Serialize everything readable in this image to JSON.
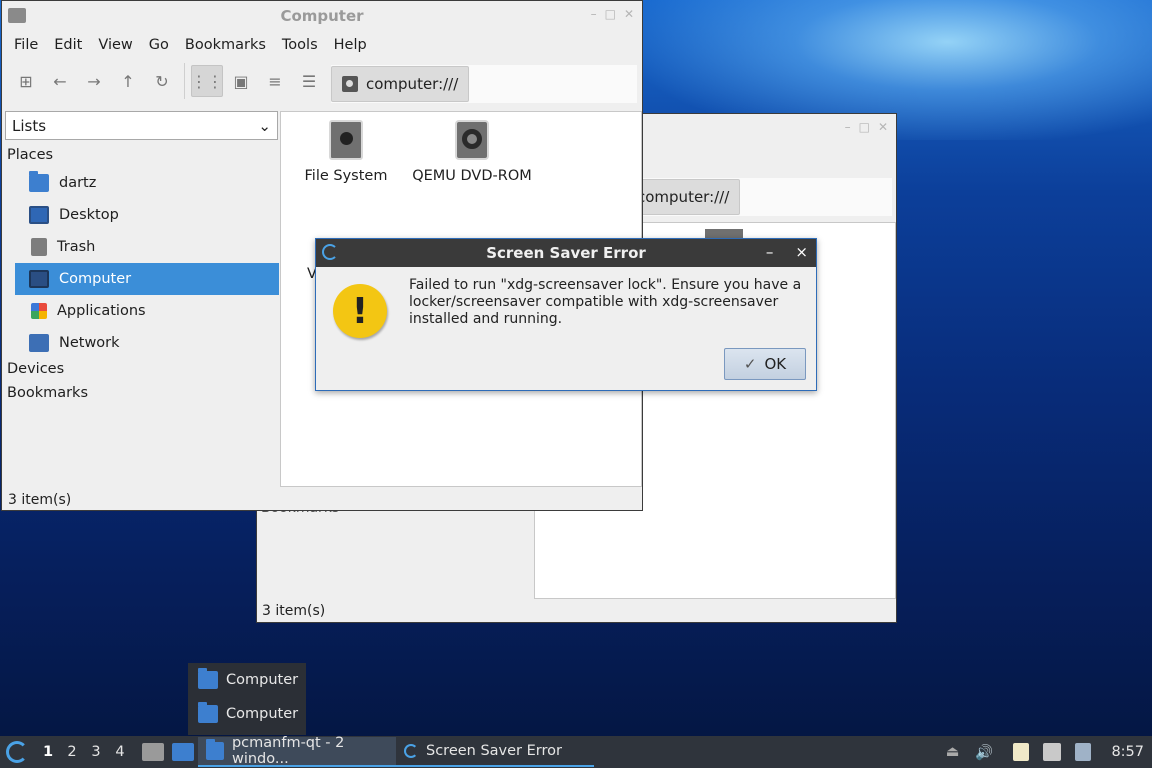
{
  "back_window": {
    "path": "computer:///",
    "section_label": "Bookmarks",
    "status": "3 item(s)"
  },
  "main_window": {
    "title": "Computer",
    "menu": [
      "File",
      "Edit",
      "View",
      "Go",
      "Bookmarks",
      "Tools",
      "Help"
    ],
    "path": "computer:///",
    "side_select": "Lists",
    "sections": {
      "places": "Places",
      "devices": "Devices",
      "bookmarks": "Bookmarks"
    },
    "places": [
      {
        "label": "dartz",
        "icon": "folder-icon"
      },
      {
        "label": "Desktop",
        "icon": "desktop-icon"
      },
      {
        "label": "Trash",
        "icon": "trash-icon"
      },
      {
        "label": "Computer",
        "icon": "computer-icon",
        "selected": true
      },
      {
        "label": "Applications",
        "icon": "applications-icon"
      },
      {
        "label": "Network",
        "icon": "network-icon"
      }
    ],
    "items": [
      {
        "label": "File System",
        "icon": "drive-icon"
      },
      {
        "label": "QEMU DVD-ROM",
        "icon": "dvd-icon"
      },
      {
        "label": "V",
        "icon": "drive-icon"
      }
    ],
    "status": "3 item(s)"
  },
  "dialog": {
    "title": "Screen Saver Error",
    "message": "Failed to run  \"xdg-screensaver lock\". Ensure you have a locker/screensaver compatible with xdg-screensaver installed and running.",
    "ok_label": "OK",
    "minimize": "–",
    "close": "×"
  },
  "window_popup": [
    "Computer",
    "Computer"
  ],
  "taskbar": {
    "desktops": [
      "1",
      "2",
      "3",
      "4"
    ],
    "tasks": [
      {
        "label": "pcmanfm-qt - 2 windo...",
        "active": true
      },
      {
        "label": "Screen Saver Error",
        "active": false
      }
    ],
    "clock": "8:57"
  },
  "colors": {
    "selection": "#3b8ed8",
    "accent": "#4aa2e6",
    "taskbar": "#2f343c"
  }
}
